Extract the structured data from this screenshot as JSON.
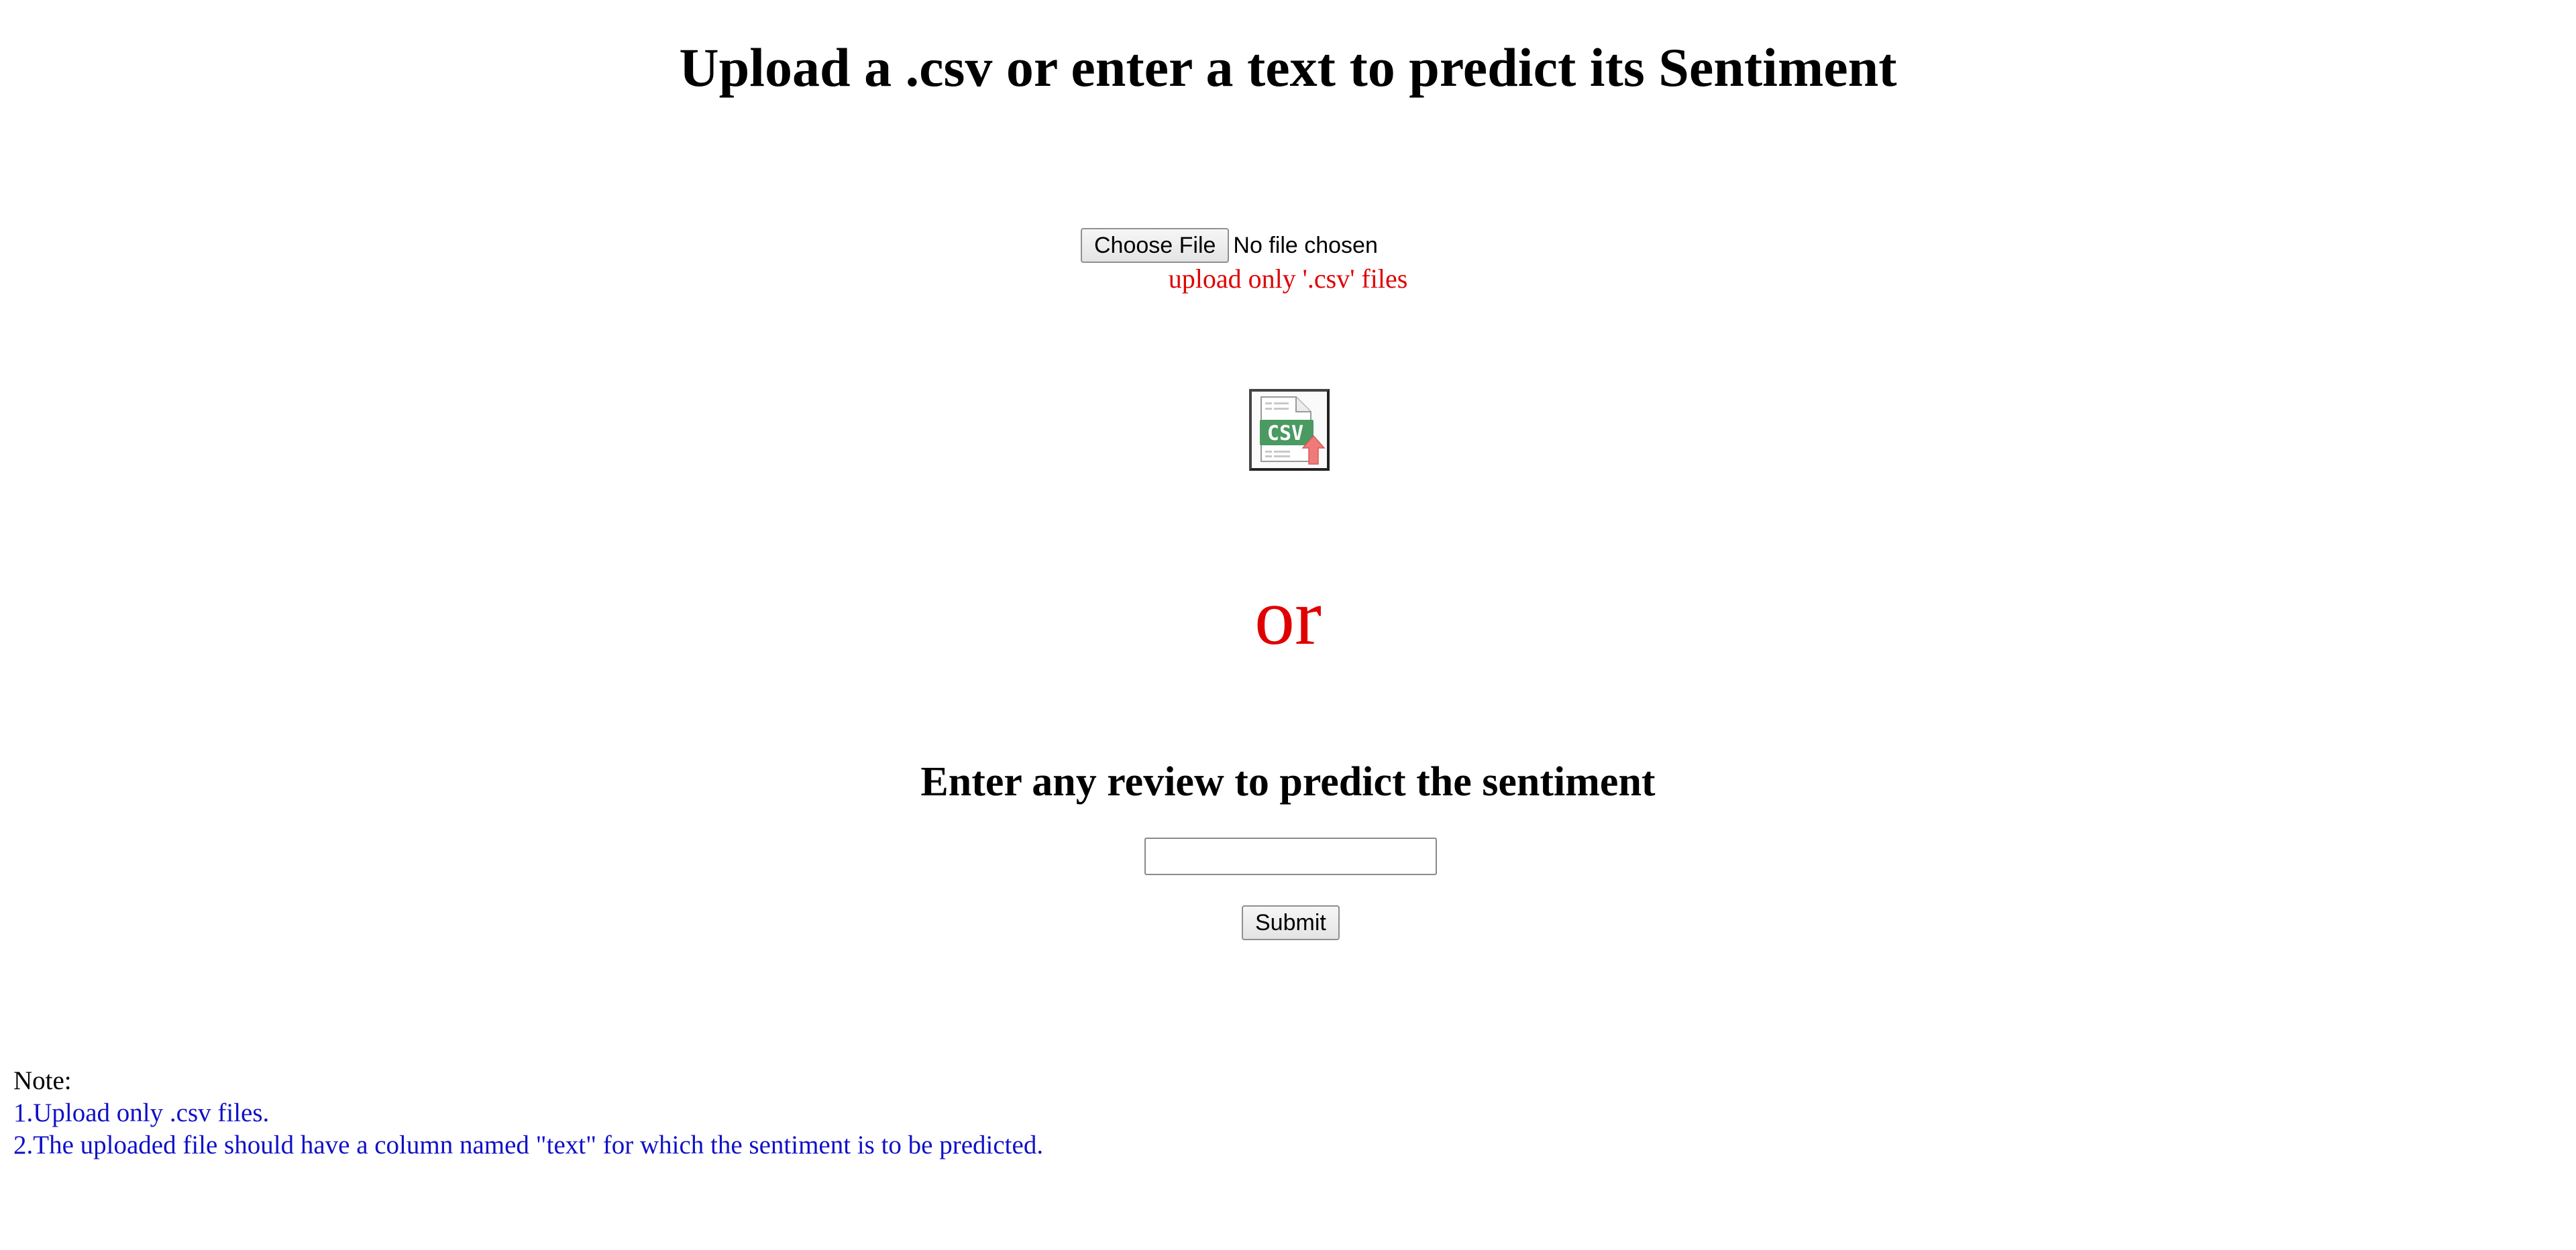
{
  "page": {
    "title": "Upload a .csv or enter a text to predict its Sentiment"
  },
  "upload": {
    "choose_file_label": "Choose File",
    "file_status": "No file chosen",
    "hint": "upload only '.csv' files",
    "icon": "csv-upload-icon",
    "icon_text": "CSV"
  },
  "separator": {
    "text": "or"
  },
  "review": {
    "heading": "Enter any review to predict the sentiment",
    "input_value": "",
    "input_placeholder": "",
    "submit_label": "Submit"
  },
  "notes": {
    "heading": "Note:",
    "items": [
      "1.Upload only .csv files.",
      "2.The uploaded file should have a column named \"text\" for which the sentiment is to be predicted."
    ]
  },
  "colors": {
    "accent_red": "#e00000",
    "note_blue": "#1010c8",
    "csv_green": "#4a9a62",
    "arrow_red": "#f07a7a"
  }
}
